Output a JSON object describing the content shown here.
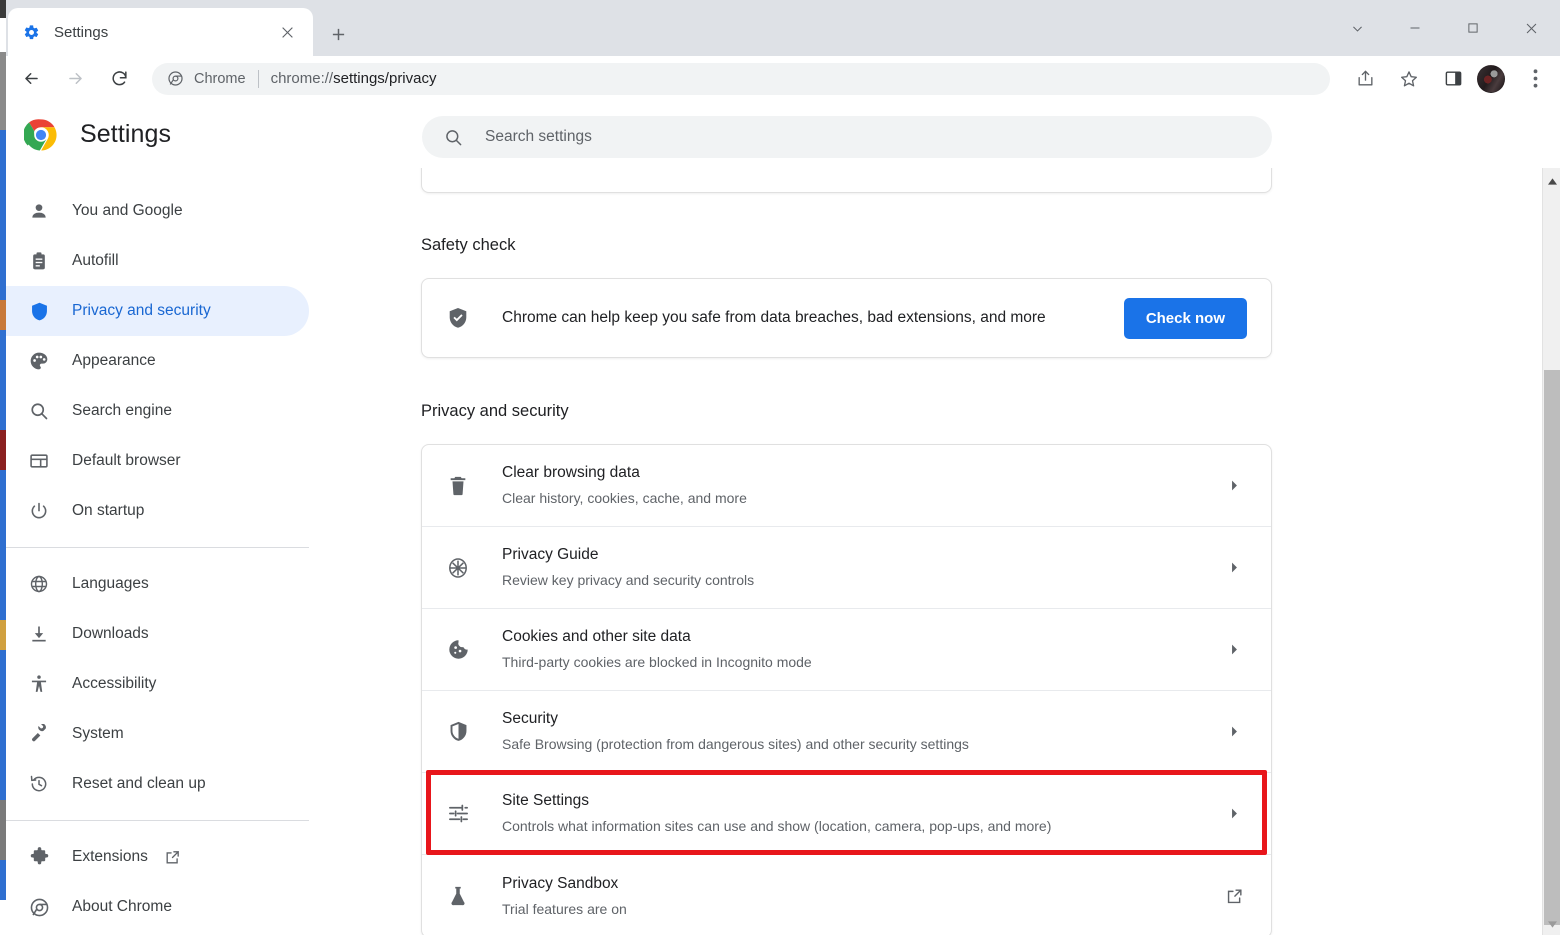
{
  "window": {
    "controls": [
      {
        "name": "tab-search",
        "glyph": "tab-search-icon"
      },
      {
        "name": "minimize",
        "glyph": "minimize-icon"
      },
      {
        "name": "maximize",
        "glyph": "maximize-icon"
      },
      {
        "name": "close",
        "glyph": "close-icon"
      }
    ]
  },
  "tab": {
    "title": "Settings",
    "favicon": "gear-icon",
    "close_label": "×",
    "new_tab_label": "+"
  },
  "toolbar": {
    "back": "back-arrow-icon",
    "forward": "forward-arrow-icon",
    "reload": "reload-icon",
    "omnibox": {
      "chrome_icon": "chrome-logo-icon",
      "scheme_label": "Chrome",
      "url_scheme": "chrome://",
      "url_path": "settings/privacy",
      "full_url": "chrome://settings/privacy"
    },
    "share": "share-icon",
    "bookmark": "star-icon",
    "side_panel": "side-panel-icon",
    "profile": "avatar",
    "menu": "three-dot-menu-icon"
  },
  "header": {
    "logo": "chrome-logo",
    "title": "Settings"
  },
  "search": {
    "icon": "search-icon",
    "placeholder": "Search settings",
    "value": ""
  },
  "sidebar": {
    "groups": [
      {
        "items": [
          {
            "label": "You and Google",
            "icon": "person-icon",
            "selected": false
          },
          {
            "label": "Autofill",
            "icon": "clipboard-icon",
            "selected": false
          },
          {
            "label": "Privacy and security",
            "icon": "shield-icon",
            "selected": true
          },
          {
            "label": "Appearance",
            "icon": "palette-icon",
            "selected": false
          },
          {
            "label": "Search engine",
            "icon": "search-icon",
            "selected": false
          },
          {
            "label": "Default browser",
            "icon": "browser-window-icon",
            "selected": false
          },
          {
            "label": "On startup",
            "icon": "power-icon",
            "selected": false
          }
        ]
      },
      {
        "items": [
          {
            "label": "Languages",
            "icon": "globe-icon",
            "selected": false
          },
          {
            "label": "Downloads",
            "icon": "download-icon",
            "selected": false
          },
          {
            "label": "Accessibility",
            "icon": "accessibility-icon",
            "selected": false
          },
          {
            "label": "System",
            "icon": "wrench-icon",
            "selected": false
          },
          {
            "label": "Reset and clean up",
            "icon": "history-restore-icon",
            "selected": false
          }
        ]
      },
      {
        "items": [
          {
            "label": "Extensions",
            "icon": "puzzle-icon",
            "selected": false,
            "external": true
          },
          {
            "label": "About Chrome",
            "icon": "chrome-logo-icon",
            "selected": false
          }
        ]
      }
    ]
  },
  "main": {
    "safety_check": {
      "section_title": "Safety check",
      "icon": "shield-check-icon",
      "description": "Chrome can help keep you safe from data breaches, bad extensions, and more",
      "button_label": "Check now"
    },
    "privacy": {
      "section_title": "Privacy and security",
      "rows": [
        {
          "title": "Clear browsing data",
          "subtitle": "Clear history, cookies, cache, and more",
          "icon": "trash-icon",
          "end": "chevron-right-icon",
          "highlighted": false
        },
        {
          "title": "Privacy Guide",
          "subtitle": "Review key privacy and security controls",
          "icon": "compass-icon",
          "end": "chevron-right-icon",
          "highlighted": false
        },
        {
          "title": "Cookies and other site data",
          "subtitle": "Third-party cookies are blocked in Incognito mode",
          "icon": "cookie-icon",
          "end": "chevron-right-icon",
          "highlighted": false
        },
        {
          "title": "Security",
          "subtitle": "Safe Browsing (protection from dangerous sites) and other security settings",
          "icon": "shield-half-icon",
          "end": "chevron-right-icon",
          "highlighted": false
        },
        {
          "title": "Site Settings",
          "subtitle": "Controls what information sites can use and show (location, camera, pop-ups, and more)",
          "icon": "tune-sliders-icon",
          "end": "chevron-right-icon",
          "highlighted": true
        },
        {
          "title": "Privacy Sandbox",
          "subtitle": "Trial features are on",
          "icon": "flask-icon",
          "end": "external-link-icon",
          "highlighted": false
        }
      ]
    }
  },
  "colors": {
    "accent_blue": "#1a73e8",
    "selected_nav_bg": "#e8f0fe",
    "selected_nav_text": "#1967d2",
    "highlight_red": "#e8161b",
    "tabstrip_bg": "#dee1e6",
    "search_bg": "#f1f3f4"
  }
}
